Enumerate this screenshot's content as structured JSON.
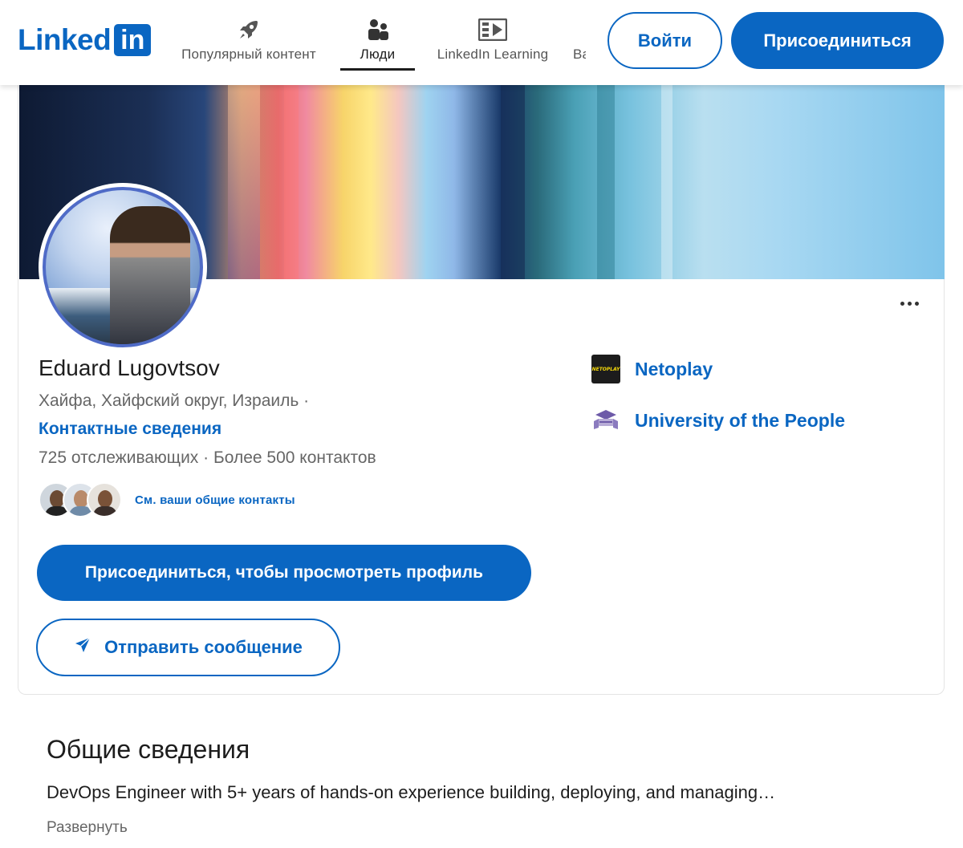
{
  "header": {
    "logo_text": "Linked",
    "logo_in": "in",
    "nav": [
      {
        "label": "Популярный контент",
        "icon": "rocket-icon"
      },
      {
        "label": "Люди",
        "icon": "people-icon",
        "active": true
      },
      {
        "label": "LinkedIn Learning",
        "icon": "video-icon"
      },
      {
        "label": "Вакансии",
        "icon": "briefcase-icon"
      }
    ],
    "login_label": "Войти",
    "join_label": "Присоединиться"
  },
  "profile": {
    "name": "Eduard Lugovtsov",
    "location": "Хайфа, Хайфский округ, Израиль  ·",
    "contact_link": "Контактные сведения",
    "stats": "725 отслеживающих  ·  Более 500 контактов",
    "mutual_text": "См. ваши общие контакты",
    "join_button": "Присоединиться, чтобы просмотреть профиль",
    "message_button": "Отправить сообщение"
  },
  "orgs": [
    {
      "name": "Netoplay",
      "logo_text": "NETOPLAY"
    },
    {
      "name": "University of the People"
    }
  ],
  "about": {
    "title": "Общие сведения",
    "text": "DevOps Engineer with 5+ years of hands-on experience building, deploying, and managing…",
    "expand": "Развернуть"
  },
  "colors": {
    "brand": "#0a66c2",
    "avatar_ring": "#4f6bc7"
  }
}
